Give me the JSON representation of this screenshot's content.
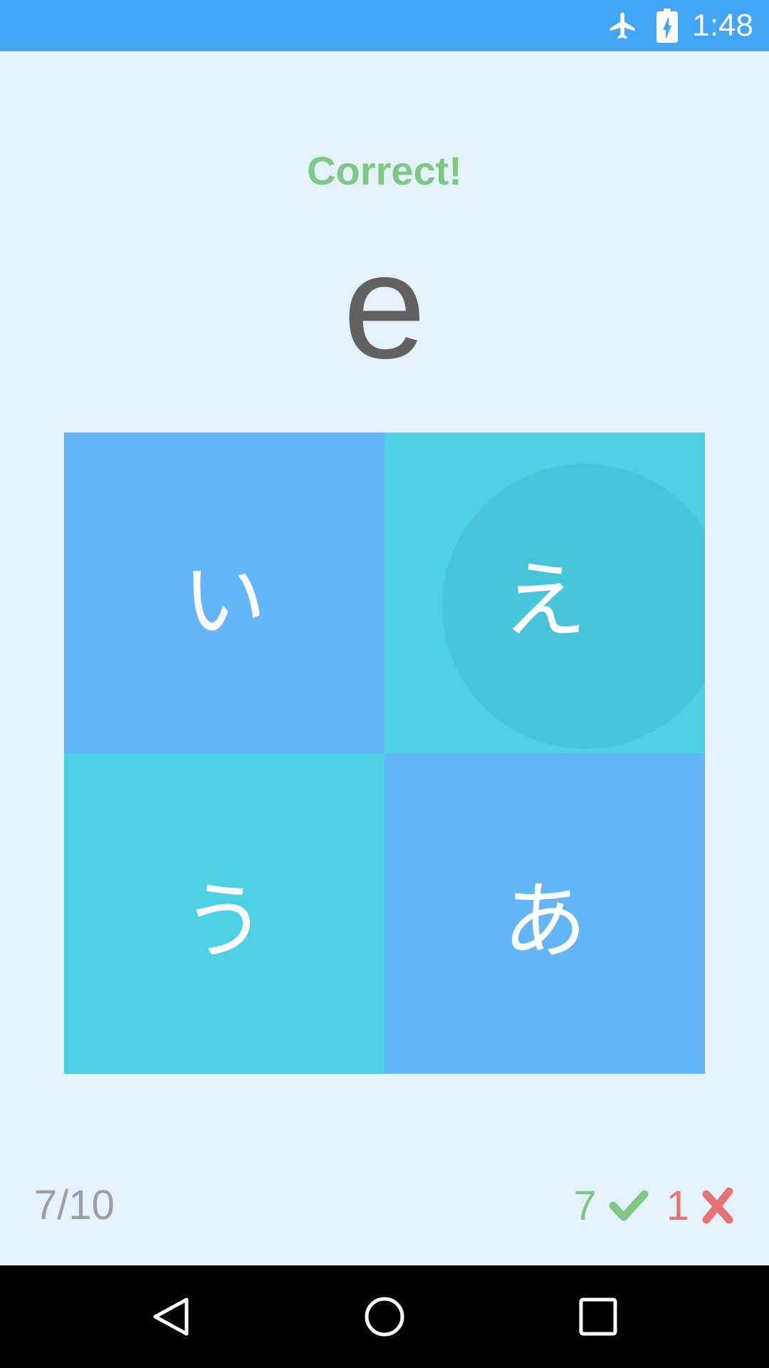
{
  "status_bar": {
    "time": "1:48",
    "icons": [
      "airplane-mode-icon",
      "battery-charging-icon"
    ]
  },
  "quiz": {
    "feedback": "Correct!",
    "prompt": "e",
    "choices": [
      {
        "kana": "い",
        "color": "#64B5F6",
        "selected": false
      },
      {
        "kana": "え",
        "color": "#4DD0E1",
        "selected": true
      },
      {
        "kana": "う",
        "color": "#4DD0E1",
        "selected": false
      },
      {
        "kana": "あ",
        "color": "#64B5F6",
        "selected": false
      }
    ]
  },
  "footer": {
    "progress": "7/10",
    "correct_count": "7",
    "wrong_count": "1",
    "icons": [
      "checkmark-icon",
      "cross-icon"
    ]
  },
  "nav_bar": {
    "icons": [
      "back-icon",
      "home-icon",
      "recents-icon"
    ]
  },
  "colors": {
    "background": "#E3F2FD",
    "status_bar": "#42A5F5",
    "correct": "#81C784",
    "wrong": "#E57373",
    "prompt": "#616161",
    "progress": "#9E9E9E"
  }
}
